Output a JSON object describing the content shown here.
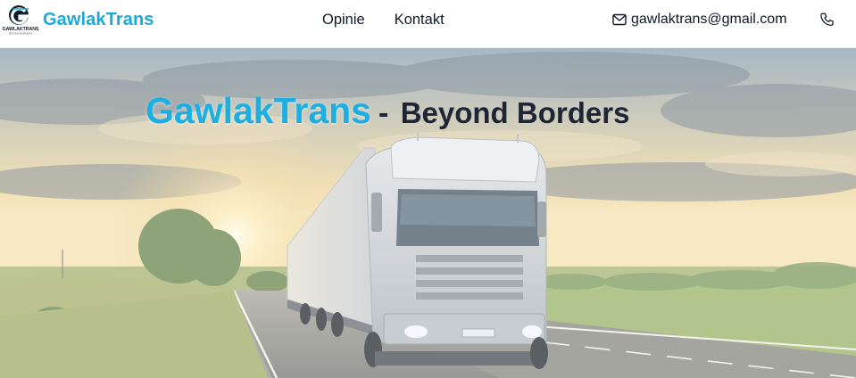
{
  "header": {
    "logo": {
      "icon": "gawlaktrans-logo-icon",
      "text": "GAWLAKTRANS",
      "subtext": "BEYOND BORDERS"
    },
    "brand_name": "GawlakTrans",
    "nav": [
      {
        "label": "Opinie"
      },
      {
        "label": "Kontakt"
      }
    ],
    "contact": {
      "email": "gawlaktrans@gmail.com",
      "email_icon": "mail-icon",
      "phone_icon": "phone-icon"
    }
  },
  "hero": {
    "title_brand": "GawlakTrans",
    "title_separator": "-",
    "title_tagline": "Beyond Borders",
    "background": "truck-on-highway-sunset-photo"
  },
  "colors": {
    "brand": "#1ba9dc",
    "text_dark": "#1d2536",
    "nav_text": "#111827"
  }
}
